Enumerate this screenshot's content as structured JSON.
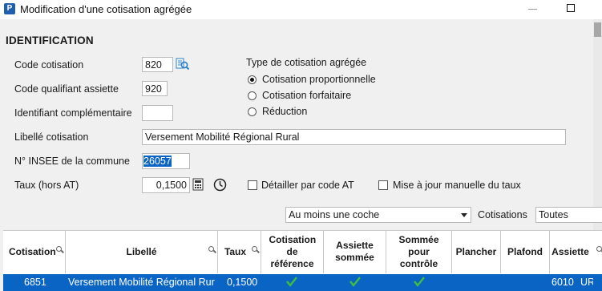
{
  "window": {
    "title": "Modification d'une cotisation agrégée",
    "app_icon": "P"
  },
  "section": {
    "title": "IDENTIFICATION"
  },
  "form": {
    "code_cotisation": {
      "label": "Code cotisation",
      "value": "820"
    },
    "code_qualifiant": {
      "label": "Code qualifiant assiette",
      "value": "920"
    },
    "identifiant_complementaire": {
      "label": "Identifiant complémentaire",
      "value": ""
    },
    "libelle": {
      "label": "Libellé cotisation",
      "value": "Versement Mobilité Régional Rural"
    },
    "insee": {
      "label": "N° INSEE de la commune",
      "value": "26057"
    },
    "taux": {
      "label": "Taux (hors AT)",
      "value": "0,1500"
    }
  },
  "type_group": {
    "title": "Type de cotisation agrégée",
    "options": [
      "Cotisation proportionnelle",
      "Cotisation forfaitaire",
      "Réduction"
    ],
    "selected_index": 0
  },
  "checks": {
    "detailler": {
      "label": "Détailler par code AT",
      "checked": false
    },
    "maj_manuelle": {
      "label": "Mise à jour manuelle du taux",
      "checked": false
    }
  },
  "filters": {
    "coche": {
      "value": "Au moins une coche"
    },
    "cotisations": {
      "label": "Cotisations",
      "value": "Toutes"
    }
  },
  "table": {
    "columns": [
      "Cotisation",
      "Libellé",
      "Taux",
      "Cotisation de référence",
      "Assiette sommée",
      "Sommée pour contrôle",
      "Plancher",
      "Plafond",
      "Assiette"
    ],
    "rows": [
      {
        "cotisation": "6851",
        "libelle": "Versement Mobilité Régional Rural",
        "taux": "0,1500",
        "reference": true,
        "assiette_sommee": true,
        "sommee_controle": true,
        "plancher": "",
        "plafond": "",
        "assiette": "6010",
        "assiette_unit": "URS"
      }
    ]
  },
  "colors": {
    "accent": "#0a64c4",
    "check": "#2f9e2f"
  }
}
